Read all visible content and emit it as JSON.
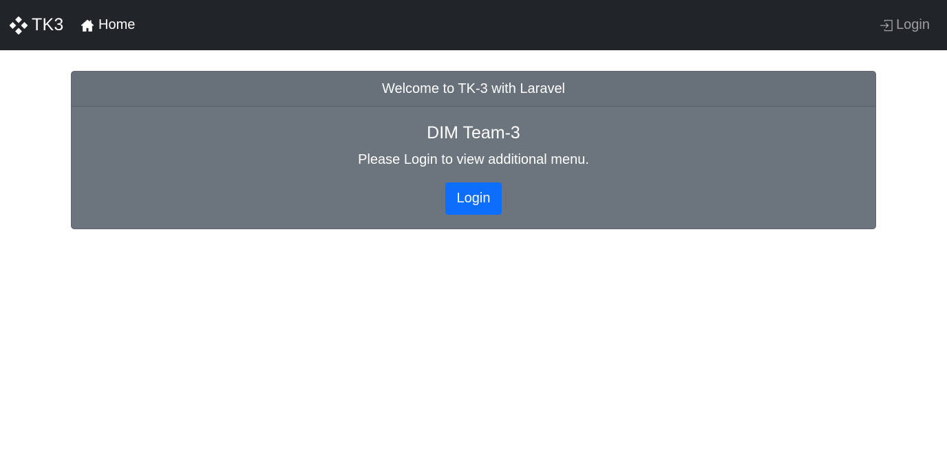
{
  "navbar": {
    "brand": {
      "text": "TK3",
      "icon": "diamond-grid-icon"
    },
    "home": {
      "label": "Home",
      "icon": "house-icon"
    },
    "login": {
      "label": "Login",
      "icon": "box-arrow-in-right-icon"
    }
  },
  "card": {
    "header": "Welcome to TK-3 with Laravel",
    "title": "DIM Team-3",
    "text": "Please Login to view additional menu.",
    "button_label": "Login"
  },
  "colors": {
    "navbar_bg": "#212529",
    "card_bg": "#6c757d",
    "primary_button": "#0d6efd",
    "nav_muted": "rgba(255,255,255,0.55)"
  }
}
